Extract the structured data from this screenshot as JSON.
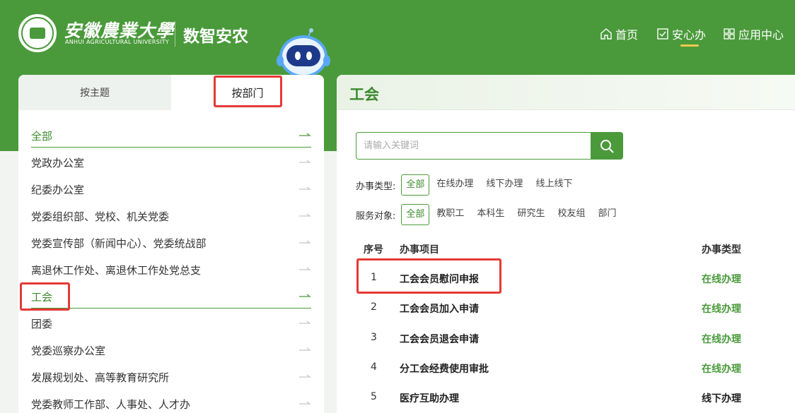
{
  "header": {
    "uni_cn": "安徽農業大學",
    "uni_en": "ANHUI AGRICULTURAL UNIVERSITY",
    "app_name": "数智安农",
    "nav": [
      {
        "label": "首页",
        "icon": "home-icon"
      },
      {
        "label": "安心办",
        "icon": "check-square-icon",
        "active": true
      },
      {
        "label": "应用中心",
        "icon": "grid-icon"
      }
    ]
  },
  "left": {
    "tabs": [
      {
        "label": "按主题"
      },
      {
        "label": "按部门",
        "active": true
      }
    ],
    "departments": [
      {
        "label": "全部",
        "active": true
      },
      {
        "label": "党政办公室"
      },
      {
        "label": "纪委办公室"
      },
      {
        "label": "党委组织部、党校、机关党委"
      },
      {
        "label": "党委宣传部（新闻中心）、党委统战部"
      },
      {
        "label": "离退休工作处、离退休工作处党总支"
      },
      {
        "label": "工会",
        "active": true
      },
      {
        "label": "团委"
      },
      {
        "label": "党委巡察办公室"
      },
      {
        "label": "发展规划处、高等教育研究所"
      },
      {
        "label": "党委教师工作部、人事处、人才办"
      }
    ]
  },
  "right": {
    "title": "工会",
    "search": {
      "placeholder": "请输入关键词"
    },
    "filters": {
      "type": {
        "label": "办事类型:",
        "options": [
          "全部",
          "在线办理",
          "线下办理",
          "线上线下"
        ],
        "selected": "全部"
      },
      "audience": {
        "label": "服务对象:",
        "options": [
          "全部",
          "教职工",
          "本科生",
          "研究生",
          "校友组",
          "部门"
        ],
        "selected": "全部"
      }
    },
    "table": {
      "headers": [
        "序号",
        "办事项目",
        "办事类型"
      ],
      "rows": [
        {
          "num": "1",
          "name": "工会会员慰问申报",
          "type": "在线办理"
        },
        {
          "num": "2",
          "name": "工会会员加入申请",
          "type": "在线办理"
        },
        {
          "num": "3",
          "name": "工会会员退会申请",
          "type": "在线办理"
        },
        {
          "num": "4",
          "name": "分工会经费使用审批",
          "type": "在线办理"
        },
        {
          "num": "5",
          "name": "医疗互助办理",
          "type": "线下办理"
        }
      ]
    }
  },
  "colors": {
    "brand_green": "#4a9a3b",
    "accent_yellow": "#f2c94c",
    "highlight_red": "#e53935"
  }
}
